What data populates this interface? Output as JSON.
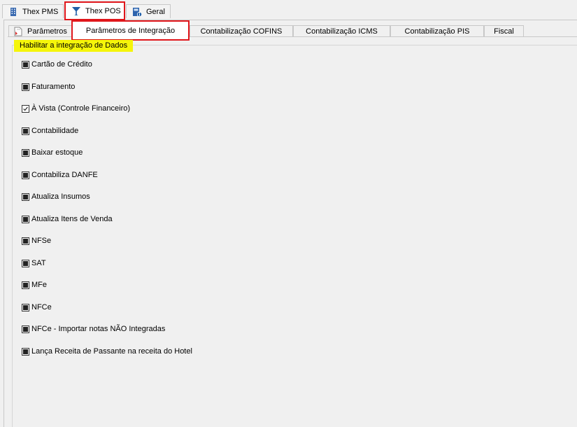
{
  "top_tabs": [
    {
      "label": "Thex PMS",
      "icon": "building-icon",
      "active": false
    },
    {
      "label": "Thex POS",
      "icon": "cocktail-glass-icon",
      "active": true
    },
    {
      "label": "Geral",
      "icon": "calculator-info-icon",
      "active": false
    }
  ],
  "sub_tabs": [
    {
      "label": "Parâmetros",
      "icon": "document-icon",
      "active": false
    },
    {
      "label": "Parâmetros de Integração",
      "active": true
    },
    {
      "label": "Contabilização COFINS",
      "active": false
    },
    {
      "label": "Contabilização ICMS",
      "active": false
    },
    {
      "label": "Contabilização PIS",
      "active": false
    },
    {
      "label": "Fiscal",
      "active": false
    }
  ],
  "group": {
    "title": "Habilitar a integração de Dados",
    "options": [
      {
        "label": "Cartão de Crédito",
        "state": "indeterminate"
      },
      {
        "label": "Faturamento",
        "state": "indeterminate"
      },
      {
        "label": "À Vista (Controle Financeiro)",
        "state": "checked"
      },
      {
        "label": "Contabilidade",
        "state": "indeterminate"
      },
      {
        "label": "Baixar estoque",
        "state": "indeterminate"
      },
      {
        "label": "Contabiliza DANFE",
        "state": "indeterminate"
      },
      {
        "label": "Atualiza Insumos",
        "state": "indeterminate"
      },
      {
        "label": "Atualiza Itens de Venda",
        "state": "indeterminate"
      },
      {
        "label": "NFSe",
        "state": "indeterminate"
      },
      {
        "label": "SAT",
        "state": "indeterminate"
      },
      {
        "label": "MFe",
        "state": "indeterminate"
      },
      {
        "label": "NFCe",
        "state": "indeterminate"
      },
      {
        "label": "NFCe - Importar notas NÃO Integradas",
        "state": "indeterminate"
      },
      {
        "label": "Lança Receita de Passante na receita do Hotel",
        "state": "indeterminate"
      }
    ]
  },
  "colors": {
    "highlight": "#e0161b",
    "legend_bg": "#f5f50a",
    "icon_blue": "#1f5fa8"
  }
}
